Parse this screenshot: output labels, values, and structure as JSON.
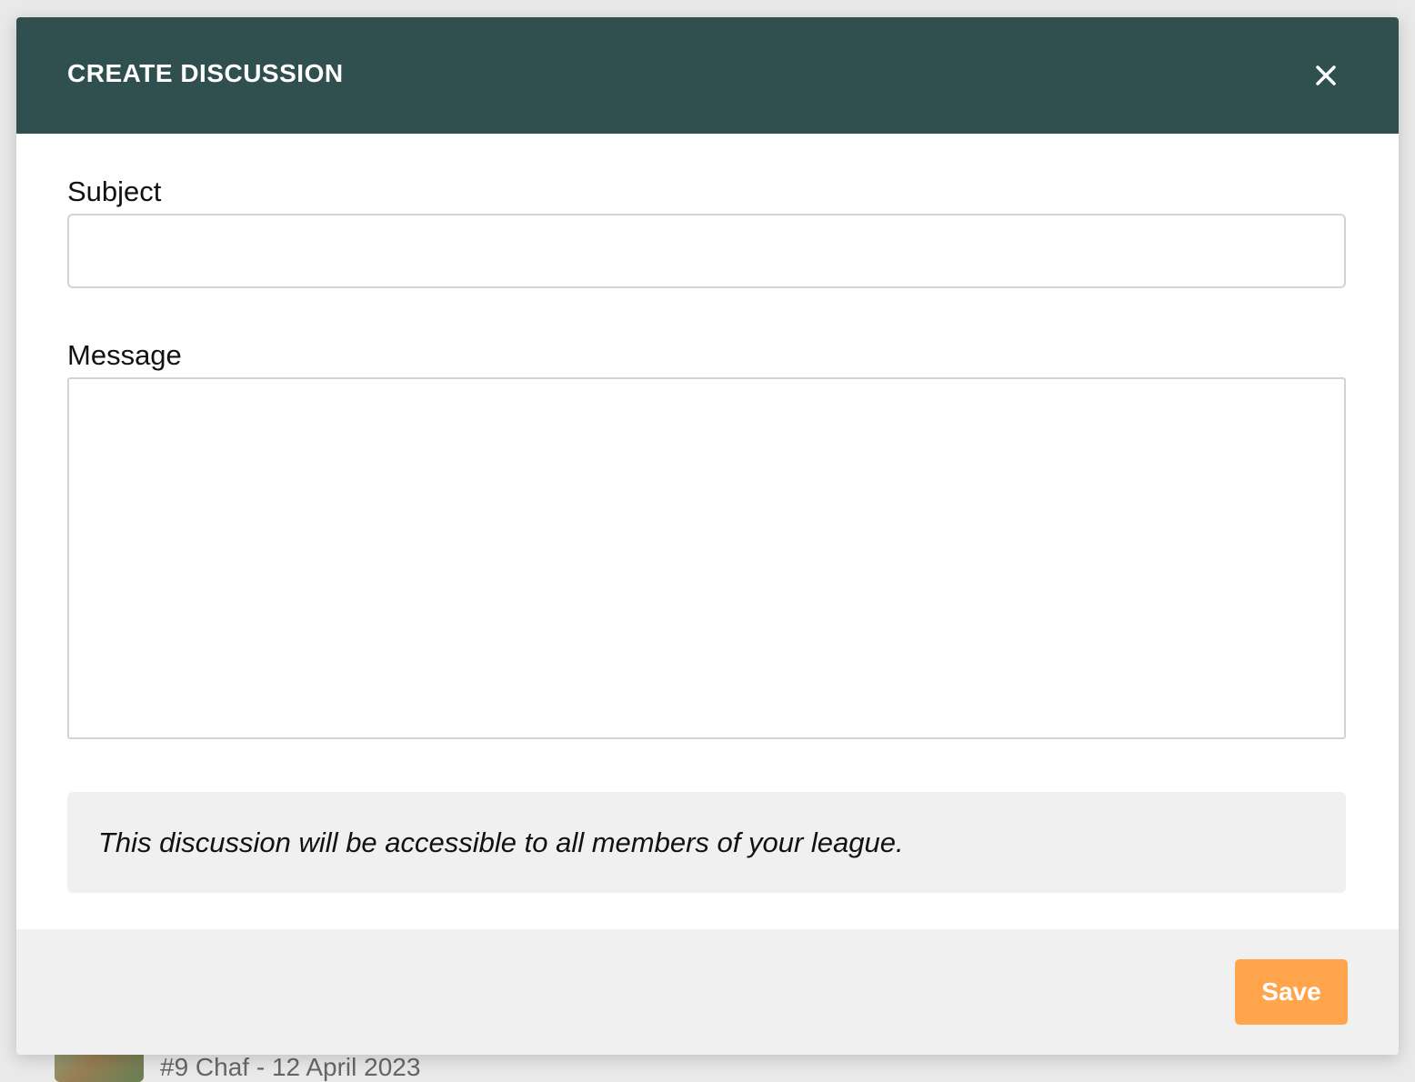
{
  "background": {
    "list_item_text": "#9 Chaf - 12 April 2023"
  },
  "modal": {
    "title": "CREATE DISCUSSION",
    "close_icon": "close-icon",
    "subject": {
      "label": "Subject",
      "value": "",
      "placeholder": ""
    },
    "message": {
      "label": "Message",
      "value": "",
      "placeholder": ""
    },
    "notice": "This discussion will be accessible to all members of your league.",
    "save_label": "Save"
  },
  "colors": {
    "header": "#304f4f",
    "save_button": "#ffa64d",
    "footer": "#f0f0f0",
    "page_background": "#e9e9e9"
  }
}
